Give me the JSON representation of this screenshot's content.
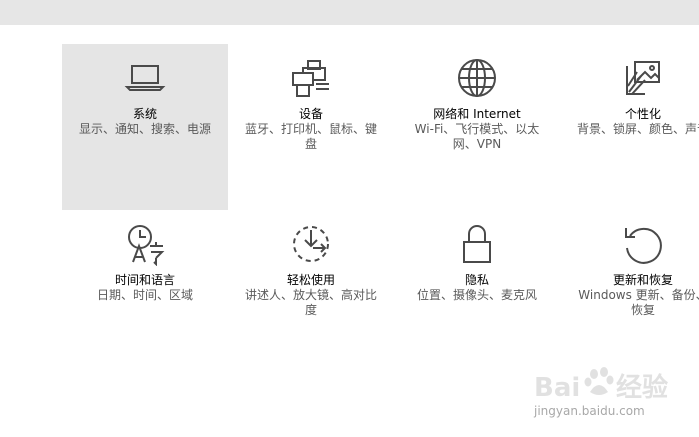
{
  "tiles": [
    {
      "key": "system",
      "icon": "laptop-icon",
      "title": "系统",
      "desc": "显示、通知、搜索、电源",
      "selected": true
    },
    {
      "key": "devices",
      "icon": "printer-keyboard-icon",
      "title": "设备",
      "desc": "蓝牙、打印机、鼠标、键盘",
      "selected": false
    },
    {
      "key": "network",
      "icon": "globe-icon",
      "title": "网络和 Internet",
      "desc": "Wi-Fi、飞行模式、以太网、VPN",
      "selected": false
    },
    {
      "key": "personalization",
      "icon": "paintbrush-picture-icon",
      "title": "个性化",
      "desc": "背景、锁屏、颜色、声音",
      "selected": false
    },
    {
      "key": "time-language",
      "icon": "clock-language-icon",
      "title": "时间和语言",
      "desc": "日期、时间、区域",
      "selected": false
    },
    {
      "key": "ease-of-access",
      "icon": "ease-of-access-icon",
      "title": "轻松使用",
      "desc": "讲述人、放大镜、高对比度",
      "selected": false
    },
    {
      "key": "privacy",
      "icon": "lock-icon",
      "title": "隐私",
      "desc": "位置、摄像头、麦克风",
      "selected": false
    },
    {
      "key": "update-security",
      "icon": "refresh-icon",
      "title": "更新和恢复",
      "desc": "Windows 更新、备份、恢复",
      "selected": false
    }
  ],
  "watermark": {
    "icon": "baidu-paw-icon",
    "text": "jingyan.baidu.com"
  },
  "colors": {
    "selected_bg": "#e5e5e5",
    "icon_stroke": "#4a4a4a",
    "desc_text": "#5a5a5a",
    "topbar": "#e6e6e6"
  }
}
